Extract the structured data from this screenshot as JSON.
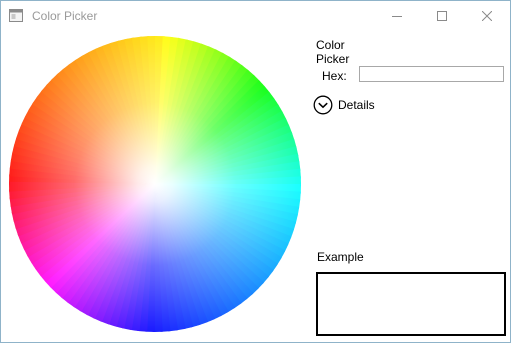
{
  "window": {
    "title": "Color Picker",
    "icon": "window-app-icon",
    "caption_buttons": {
      "minimize": "minimize-icon",
      "maximize": "maximize-icon",
      "close": "close-icon"
    }
  },
  "color_wheel": {
    "icon": "color-wheel"
  },
  "panel": {
    "title": "Color Picker",
    "hex_label": "Hex:",
    "hex_value": "",
    "details_label": "Details",
    "details_icon": "chevron-down-circle-icon",
    "example_label": "Example",
    "example_color": "#ffffff"
  },
  "colors": {
    "window_border": "#8fb3c9",
    "title_text": "#9a9a9a",
    "input_border": "#a8a8a8",
    "example_border": "#000000"
  }
}
